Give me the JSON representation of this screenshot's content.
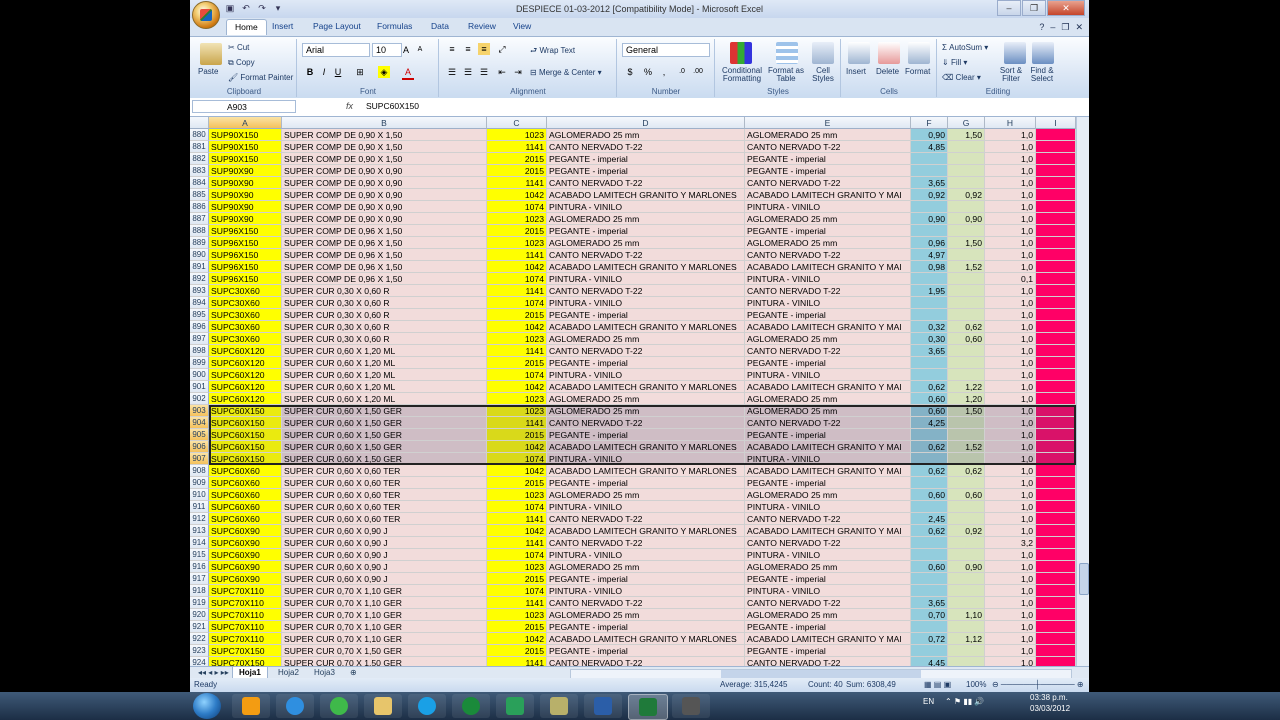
{
  "window": {
    "title": "DESPIECE 01-03-2012  [Compatibility Mode] - Microsoft Excel",
    "controls": [
      "–",
      "❐",
      "✕"
    ]
  },
  "ribbon_tabs": [
    "Home",
    "Insert",
    "Page Layout",
    "Formulas",
    "Data",
    "Review",
    "View"
  ],
  "ribbon": {
    "clipboard": {
      "paste": "Paste",
      "cut": "Cut",
      "copy": "Copy",
      "format_painter": "Format Painter",
      "label": "Clipboard"
    },
    "font": {
      "name": "Arial",
      "size": "10",
      "label": "Font"
    },
    "alignment": {
      "wrap": "Wrap Text",
      "merge": "Merge & Center",
      "label": "Alignment"
    },
    "number": {
      "format": "General",
      "label": "Number"
    },
    "styles": {
      "cond": "Conditional Formatting",
      "table": "Format as Table",
      "cell": "Cell Styles",
      "label": "Styles"
    },
    "cells": {
      "insert": "Insert",
      "delete": "Delete",
      "format": "Format",
      "label": "Cells"
    },
    "editing": {
      "autosum": "AutoSum",
      "fill": "Fill",
      "clear": "Clear",
      "sort": "Sort & Filter",
      "find": "Find & Select",
      "label": "Editing"
    }
  },
  "formula_bar": {
    "name_box": "A903",
    "fx": "fx",
    "value": "SUPC60X150"
  },
  "columns": [
    "A",
    "B",
    "C",
    "D",
    "E",
    "F",
    "G",
    "H",
    "I"
  ],
  "colors": {
    "a": "#ffff00",
    "b": "#f2dcdb",
    "c": "#ffff00",
    "d": "#f2dcdb",
    "e": "#f2dcdb",
    "f": "#93cddd",
    "g": "#d7e4bc",
    "h": "#f2dcdb",
    "i": "#ff0066",
    "selected": "#c8c8d8"
  },
  "rows": [
    {
      "n": "880",
      "a": "SUP90X150",
      "b": "SUPER COMP DE 0,90 X 1,50",
      "c": "1023",
      "d": "AGLOMERADO 25 mm",
      "e": "AGLOMERADO 25 mm",
      "f": "0,90",
      "g": "1,50",
      "h": "1,0"
    },
    {
      "n": "881",
      "a": "SUP90X150",
      "b": "SUPER COMP DE 0,90 X 1,50",
      "c": "1141",
      "d": "CANTO NERVADO T-22",
      "e": "CANTO NERVADO T-22",
      "f": "4,85",
      "g": "",
      "h": "1,0"
    },
    {
      "n": "882",
      "a": "SUP90X150",
      "b": "SUPER COMP DE 0,90 X 1,50",
      "c": "2015",
      "d": "PEGANTE - imperial",
      "e": "PEGANTE - imperial",
      "f": "",
      "g": "",
      "h": "1,0"
    },
    {
      "n": "883",
      "a": "SUP90X90",
      "b": "SUPER COMP DE 0,90 X 0,90",
      "c": "2015",
      "d": "PEGANTE - imperial",
      "e": "PEGANTE - imperial",
      "f": "",
      "g": "",
      "h": "1,0"
    },
    {
      "n": "884",
      "a": "SUP90X90",
      "b": "SUPER COMP DE 0,90 X 0,90",
      "c": "1141",
      "d": "CANTO NERVADO T-22",
      "e": "CANTO NERVADO T-22",
      "f": "3,65",
      "g": "",
      "h": "1,0"
    },
    {
      "n": "885",
      "a": "SUP90X90",
      "b": "SUPER COMP DE 0,90 X 0,90",
      "c": "1042",
      "d": "ACABADO LAMITECH GRANITO Y MARLONES",
      "e": "ACABADO LAMITECH GRANITO Y MAI",
      "f": "0,92",
      "g": "0,92",
      "h": "1,0"
    },
    {
      "n": "886",
      "a": "SUP90X90",
      "b": "SUPER COMP DE 0,90 X 0,90",
      "c": "1074",
      "d": "PINTURA - VINILO",
      "e": "PINTURA - VINILO",
      "f": "",
      "g": "",
      "h": "1,0"
    },
    {
      "n": "887",
      "a": "SUP90X90",
      "b": "SUPER COMP DE 0,90 X 0,90",
      "c": "1023",
      "d": "AGLOMERADO 25 mm",
      "e": "AGLOMERADO 25 mm",
      "f": "0,90",
      "g": "0,90",
      "h": "1,0"
    },
    {
      "n": "888",
      "a": "SUP96X150",
      "b": "SUPER COMP DE 0,96 X 1,50",
      "c": "2015",
      "d": "PEGANTE - imperial",
      "e": "PEGANTE - imperial",
      "f": "",
      "g": "",
      "h": "1,0"
    },
    {
      "n": "889",
      "a": "SUP96X150",
      "b": "SUPER COMP DE 0,96 X 1,50",
      "c": "1023",
      "d": "AGLOMERADO 25 mm",
      "e": "AGLOMERADO 25 mm",
      "f": "0,96",
      "g": "1,50",
      "h": "1,0"
    },
    {
      "n": "890",
      "a": "SUP96X150",
      "b": "SUPER COMP DE 0,96 X 1,50",
      "c": "1141",
      "d": "CANTO NERVADO T-22",
      "e": "CANTO NERVADO T-22",
      "f": "4,97",
      "g": "",
      "h": "1,0"
    },
    {
      "n": "891",
      "a": "SUP96X150",
      "b": "SUPER COMP DE 0,96 X 1,50",
      "c": "1042",
      "d": "ACABADO LAMITECH GRANITO Y MARLONES",
      "e": "ACABADO LAMITECH GRANITO Y MAI",
      "f": "0,98",
      "g": "1,52",
      "h": "1,0"
    },
    {
      "n": "892",
      "a": "SUP96X150",
      "b": "SUPER COMP DE 0,96 X 1,50",
      "c": "1074",
      "d": "PINTURA - VINILO",
      "e": "PINTURA - VINILO",
      "f": "",
      "g": "",
      "h": "0,1"
    },
    {
      "n": "893",
      "a": "SUPC30X60",
      "b": "SUPER CUR 0,30 X 0,60 R",
      "c": "1141",
      "d": "CANTO NERVADO T-22",
      "e": "CANTO NERVADO T-22",
      "f": "1,95",
      "g": "",
      "h": "1,0"
    },
    {
      "n": "894",
      "a": "SUPC30X60",
      "b": "SUPER CUR 0,30 X 0,60 R",
      "c": "1074",
      "d": "PINTURA - VINILO",
      "e": "PINTURA - VINILO",
      "f": "",
      "g": "",
      "h": "1,0"
    },
    {
      "n": "895",
      "a": "SUPC30X60",
      "b": "SUPER CUR 0,30 X 0,60 R",
      "c": "2015",
      "d": "PEGANTE - imperial",
      "e": "PEGANTE - imperial",
      "f": "",
      "g": "",
      "h": "1,0"
    },
    {
      "n": "896",
      "a": "SUPC30X60",
      "b": "SUPER CUR 0,30 X 0,60 R",
      "c": "1042",
      "d": "ACABADO LAMITECH GRANITO Y MARLONES",
      "e": "ACABADO LAMITECH GRANITO Y MAI",
      "f": "0,32",
      "g": "0,62",
      "h": "1,0"
    },
    {
      "n": "897",
      "a": "SUPC30X60",
      "b": "SUPER CUR 0,30 X 0,60 R",
      "c": "1023",
      "d": "AGLOMERADO 25 mm",
      "e": "AGLOMERADO 25 mm",
      "f": "0,30",
      "g": "0,60",
      "h": "1,0"
    },
    {
      "n": "898",
      "a": "SUPC60X120",
      "b": "SUPER CUR 0,60 X 1,20 ML",
      "c": "1141",
      "d": "CANTO NERVADO T-22",
      "e": "CANTO NERVADO T-22",
      "f": "3,65",
      "g": "",
      "h": "1,0"
    },
    {
      "n": "899",
      "a": "SUPC60X120",
      "b": "SUPER CUR 0,60 X 1,20 ML",
      "c": "2015",
      "d": "PEGANTE - imperial",
      "e": "PEGANTE - imperial",
      "f": "",
      "g": "",
      "h": "1,0"
    },
    {
      "n": "900",
      "a": "SUPC60X120",
      "b": "SUPER CUR 0,60 X 1,20 ML",
      "c": "1074",
      "d": "PINTURA - VINILO",
      "e": "PINTURA - VINILO",
      "f": "",
      "g": "",
      "h": "1,0"
    },
    {
      "n": "901",
      "a": "SUPC60X120",
      "b": "SUPER CUR 0,60 X 1,20 ML",
      "c": "1042",
      "d": "ACABADO LAMITECH GRANITO Y MARLONES",
      "e": "ACABADO LAMITECH GRANITO Y MAI",
      "f": "0,62",
      "g": "1,22",
      "h": "1,0"
    },
    {
      "n": "902",
      "a": "SUPC60X120",
      "b": "SUPER CUR 0,60 X 1,20 ML",
      "c": "1023",
      "d": "AGLOMERADO 25 mm",
      "e": "AGLOMERADO 25 mm",
      "f": "0,60",
      "g": "1,20",
      "h": "1,0"
    },
    {
      "n": "903",
      "a": "SUPC60X150",
      "b": "SUPER CUR 0,60 X 1,50 GER",
      "c": "1023",
      "d": "AGLOMERADO 25 mm",
      "e": "AGLOMERADO 25 mm",
      "f": "0,60",
      "g": "1,50",
      "h": "1,0",
      "sel": true
    },
    {
      "n": "904",
      "a": "SUPC60X150",
      "b": "SUPER CUR 0,60 X 1,50 GER",
      "c": "1141",
      "d": "CANTO NERVADO T-22",
      "e": "CANTO NERVADO T-22",
      "f": "4,25",
      "g": "",
      "h": "1,0",
      "sel": true
    },
    {
      "n": "905",
      "a": "SUPC60X150",
      "b": "SUPER CUR 0,60 X 1,50 GER",
      "c": "2015",
      "d": "PEGANTE - imperial",
      "e": "PEGANTE - imperial",
      "f": "",
      "g": "",
      "h": "1,0",
      "sel": true
    },
    {
      "n": "906",
      "a": "SUPC60X150",
      "b": "SUPER CUR 0,60 X 1,50 GER",
      "c": "1042",
      "d": "ACABADO LAMITECH GRANITO Y MARLONES",
      "e": "ACABADO LAMITECH GRANITO Y MAI",
      "f": "0,62",
      "g": "1,52",
      "h": "1,0",
      "sel": true
    },
    {
      "n": "907",
      "a": "SUPC60X150",
      "b": "SUPER CUR 0,60 X 1,50 GER",
      "c": "1074",
      "d": "PINTURA - VINILO",
      "e": "PINTURA - VINILO",
      "f": "",
      "g": "",
      "h": "1,0",
      "sel": true
    },
    {
      "n": "908",
      "a": "SUPC60X60",
      "b": "SUPER CUR 0,60 X 0,60 TER",
      "c": "1042",
      "d": "ACABADO LAMITECH GRANITO Y MARLONES",
      "e": "ACABADO LAMITECH GRANITO Y MAI",
      "f": "0,62",
      "g": "0,62",
      "h": "1,0"
    },
    {
      "n": "909",
      "a": "SUPC60X60",
      "b": "SUPER CUR 0,60 X 0,60 TER",
      "c": "2015",
      "d": "PEGANTE - imperial",
      "e": "PEGANTE - imperial",
      "f": "",
      "g": "",
      "h": "1,0"
    },
    {
      "n": "910",
      "a": "SUPC60X60",
      "b": "SUPER CUR 0,60 X 0,60 TER",
      "c": "1023",
      "d": "AGLOMERADO 25 mm",
      "e": "AGLOMERADO 25 mm",
      "f": "0,60",
      "g": "0,60",
      "h": "1,0"
    },
    {
      "n": "911",
      "a": "SUPC60X60",
      "b": "SUPER CUR 0,60 X 0,60 TER",
      "c": "1074",
      "d": "PINTURA - VINILO",
      "e": "PINTURA - VINILO",
      "f": "",
      "g": "",
      "h": "1,0"
    },
    {
      "n": "912",
      "a": "SUPC60X60",
      "b": "SUPER CUR 0,60 X 0,60 TER",
      "c": "1141",
      "d": "CANTO NERVADO T-22",
      "e": "CANTO NERVADO T-22",
      "f": "2,45",
      "g": "",
      "h": "1,0"
    },
    {
      "n": "913",
      "a": "SUPC60X90",
      "b": "SUPER CUR 0,60 X 0,90 J",
      "c": "1042",
      "d": "ACABADO LAMITECH GRANITO Y MARLONES",
      "e": "ACABADO LAMITECH GRANITO Y MAI",
      "f": "0,62",
      "g": "0,92",
      "h": "1,0"
    },
    {
      "n": "914",
      "a": "SUPC60X90",
      "b": "SUPER CUR 0,60 X 0,90 J",
      "c": "1141",
      "d": "CANTO NERVADO T-22",
      "e": "CANTO NERVADO T-22",
      "f": "",
      "g": "",
      "h": "3,2"
    },
    {
      "n": "915",
      "a": "SUPC60X90",
      "b": "SUPER CUR 0,60 X 0,90 J",
      "c": "1074",
      "d": "PINTURA - VINILO",
      "e": "PINTURA - VINILO",
      "f": "",
      "g": "",
      "h": "1,0"
    },
    {
      "n": "916",
      "a": "SUPC60X90",
      "b": "SUPER CUR 0,60 X 0,90 J",
      "c": "1023",
      "d": "AGLOMERADO 25 mm",
      "e": "AGLOMERADO 25 mm",
      "f": "0,60",
      "g": "0,90",
      "h": "1,0"
    },
    {
      "n": "917",
      "a": "SUPC60X90",
      "b": "SUPER CUR 0,60 X 0,90 J",
      "c": "2015",
      "d": "PEGANTE - imperial",
      "e": "PEGANTE - imperial",
      "f": "",
      "g": "",
      "h": "1,0"
    },
    {
      "n": "918",
      "a": "SUPC70X110",
      "b": "SUPER CUR 0,70 X 1,10 GER",
      "c": "1074",
      "d": "PINTURA - VINILO",
      "e": "PINTURA - VINILO",
      "f": "",
      "g": "",
      "h": "1,0"
    },
    {
      "n": "919",
      "a": "SUPC70X110",
      "b": "SUPER CUR 0,70 X 1,10 GER",
      "c": "1141",
      "d": "CANTO NERVADO T-22",
      "e": "CANTO NERVADO T-22",
      "f": "3,65",
      "g": "",
      "h": "1,0"
    },
    {
      "n": "920",
      "a": "SUPC70X110",
      "b": "SUPER CUR 0,70 X 1,10 GER",
      "c": "1023",
      "d": "AGLOMERADO 25 mm",
      "e": "AGLOMERADO 25 mm",
      "f": "0,70",
      "g": "1,10",
      "h": "1,0"
    },
    {
      "n": "921",
      "a": "SUPC70X110",
      "b": "SUPER CUR 0,70 X 1,10 GER",
      "c": "2015",
      "d": "PEGANTE - imperial",
      "e": "PEGANTE - imperial",
      "f": "",
      "g": "",
      "h": "1,0"
    },
    {
      "n": "922",
      "a": "SUPC70X110",
      "b": "SUPER CUR 0,70 X 1,10 GER",
      "c": "1042",
      "d": "ACABADO LAMITECH GRANITO Y MARLONES",
      "e": "ACABADO LAMITECH GRANITO Y MAI",
      "f": "0,72",
      "g": "1,12",
      "h": "1,0"
    },
    {
      "n": "923",
      "a": "SUPC70X150",
      "b": "SUPER CUR 0,70 X 1,50 GER",
      "c": "2015",
      "d": "PEGANTE - imperial",
      "e": "PEGANTE - imperial",
      "f": "",
      "g": "",
      "h": "1,0"
    },
    {
      "n": "924",
      "a": "SUPC70X150",
      "b": "SUPER CUR 0,70 X 1,50 GER",
      "c": "1141",
      "d": "CANTO NERVADO T-22",
      "e": "CANTO NERVADO T-22",
      "f": "4,45",
      "g": "",
      "h": "1,0"
    }
  ],
  "sheets": [
    "Hoja1",
    "Hoja2",
    "Hoja3"
  ],
  "status": {
    "ready": "Ready",
    "average": "Average: 315,4245",
    "count": "Count: 40",
    "sum": "Sum: 6308,49",
    "zoom": "100%"
  },
  "taskbar": {
    "lang": "EN",
    "time": "03:38 p.m.",
    "date": "03/03/2012"
  }
}
